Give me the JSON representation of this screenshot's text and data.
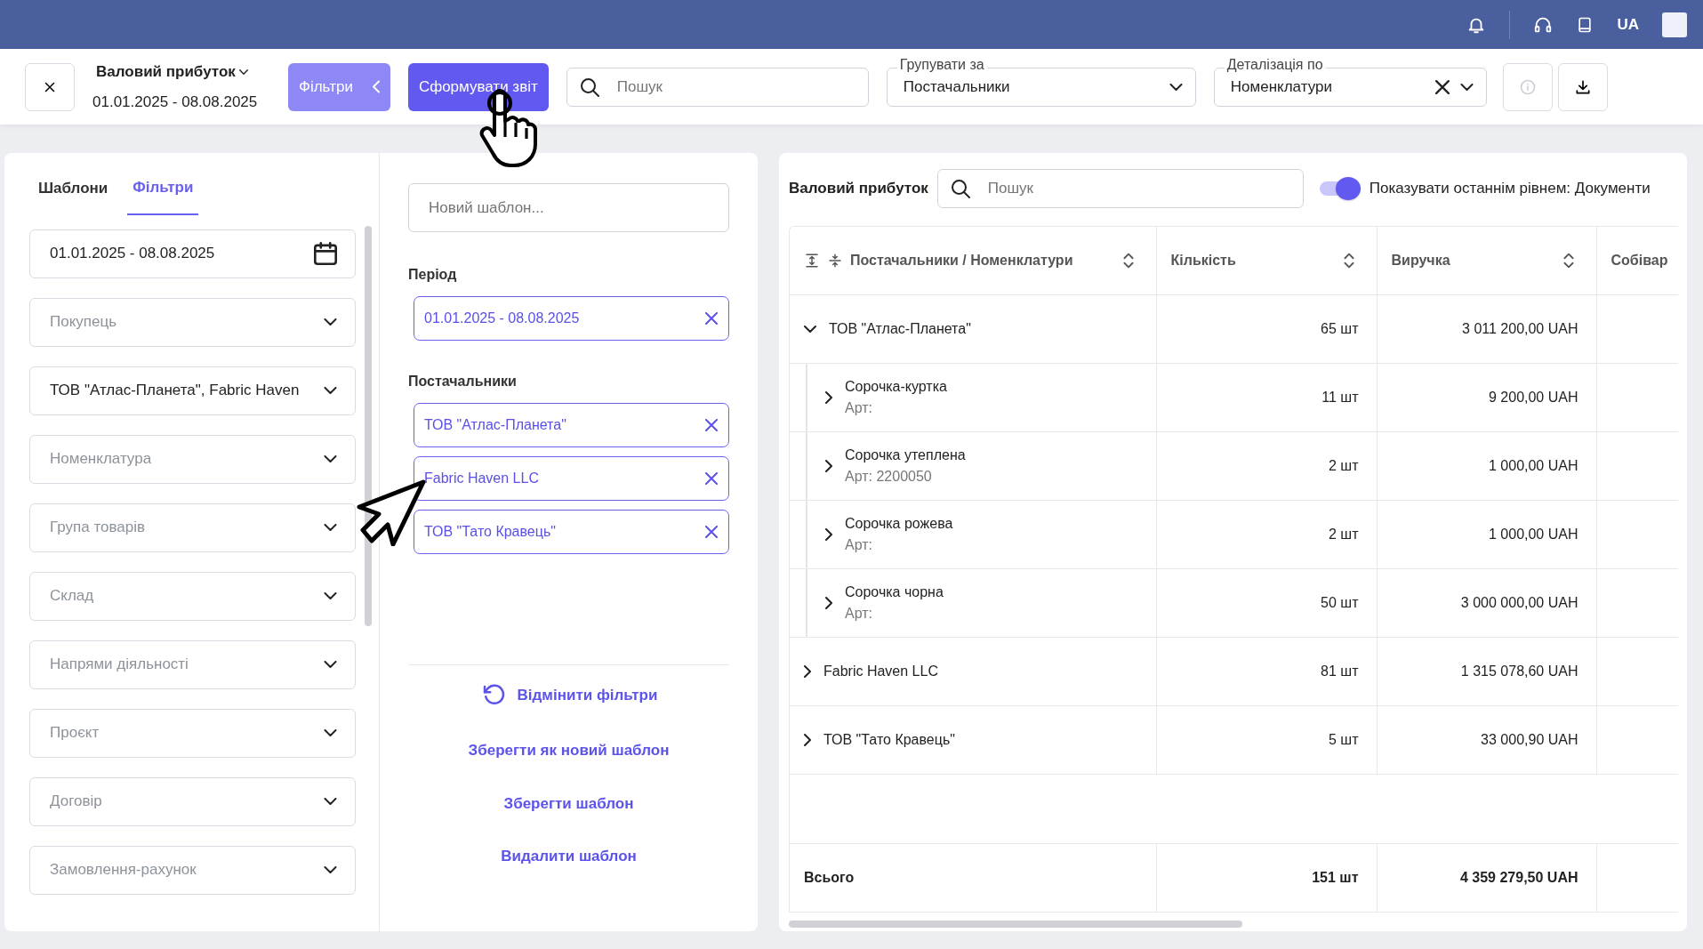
{
  "topbar": {
    "language": "UA"
  },
  "header": {
    "title": "Валовий прибуток",
    "period": "01.01.2025 - 08.08.2025",
    "filters_button": "Фільтри",
    "generate_button": "Сформувати звіт",
    "search": {
      "placeholder": "Пошук"
    },
    "group_by": {
      "label": "Групувати за",
      "value": "Постачальники"
    },
    "detail_by": {
      "label": "Деталізація по",
      "value": "Номенклатури"
    },
    "info_disabled": true
  },
  "sidebar": {
    "tabs": [
      {
        "label": "Шаблони",
        "selected": false
      },
      {
        "label": "Фільтри",
        "selected": true
      }
    ],
    "fields": [
      {
        "kind": "date",
        "value": "01.01.2025 - 08.08.2025"
      },
      {
        "kind": "select",
        "placeholder": "Покупець"
      },
      {
        "kind": "select",
        "value": "ТОВ \"Атлас-Планета\", Fabric Haven"
      },
      {
        "kind": "select",
        "placeholder": "Номенклатура"
      },
      {
        "kind": "select",
        "placeholder": "Група товарів"
      },
      {
        "kind": "select",
        "placeholder": "Склад"
      },
      {
        "kind": "select",
        "placeholder": "Напрями діяльності"
      },
      {
        "kind": "select",
        "placeholder": "Проєкт"
      },
      {
        "kind": "select",
        "placeholder": "Договір"
      },
      {
        "kind": "select",
        "placeholder": "Замовлення-рахунок"
      }
    ]
  },
  "template_panel": {
    "name": {
      "placeholder": "Новий шаблон..."
    },
    "sections": [
      {
        "title": "Період",
        "chips": [
          "01.01.2025 - 08.08.2025"
        ]
      },
      {
        "title": "Постачальники",
        "chips": [
          "ТОВ \"Атлас-Планета\"",
          "Fabric Haven LLC",
          "ТОВ \"Тато Кравець\""
        ]
      }
    ],
    "actions": [
      {
        "kind": "reset",
        "label": "Відмінити фільтри"
      },
      {
        "kind": "link",
        "label": "Зберегти як новий шаблон"
      },
      {
        "kind": "link",
        "label": "Зберегти шаблон"
      },
      {
        "kind": "link",
        "label": "Видалити шаблон"
      }
    ]
  },
  "report": {
    "title": "Валовий прибуток",
    "search": {
      "placeholder": "Пошук"
    },
    "toggle": {
      "label": "Показувати останнім рівнем: Документи",
      "on": true
    },
    "columns": [
      "Постачальники / Номенклатури",
      "Кількість",
      "Виручка",
      "Собівар"
    ],
    "rows": [
      {
        "name": "ТОВ \"Атлас-Планета\"",
        "qty": "65 шт",
        "revenue": "3 011 200,00 UAH",
        "expanded": true,
        "children": [
          {
            "name": "Сорочка-куртка",
            "sku": "Арт:",
            "qty": "11 шт",
            "revenue": "9 200,00 UAH",
            "expanded": false
          },
          {
            "name": "Сорочка утеплена",
            "sku": "Арт: 2200050",
            "qty": "2 шт",
            "revenue": "1 000,00 UAH",
            "expanded": false
          },
          {
            "name": "Сорочка рожева",
            "sku": "Арт:",
            "qty": "2 шт",
            "revenue": "1 000,00 UAH",
            "expanded": false
          },
          {
            "name": "Сорочка чорна",
            "sku": "Арт:",
            "qty": "50 шт",
            "revenue": "3 000 000,00 UAH",
            "expanded": false
          }
        ]
      },
      {
        "name": "Fabric Haven LLC",
        "qty": "81 шт",
        "revenue": "1 315 078,60 UAH",
        "expanded": false
      },
      {
        "name": "ТОВ \"Тато Кравець\"",
        "qty": "5 шт",
        "revenue": "33 000,90 UAH",
        "expanded": false
      }
    ],
    "total": {
      "label": "Всього",
      "qty": "151 шт",
      "revenue": "4 359 279,50 UAH"
    }
  }
}
